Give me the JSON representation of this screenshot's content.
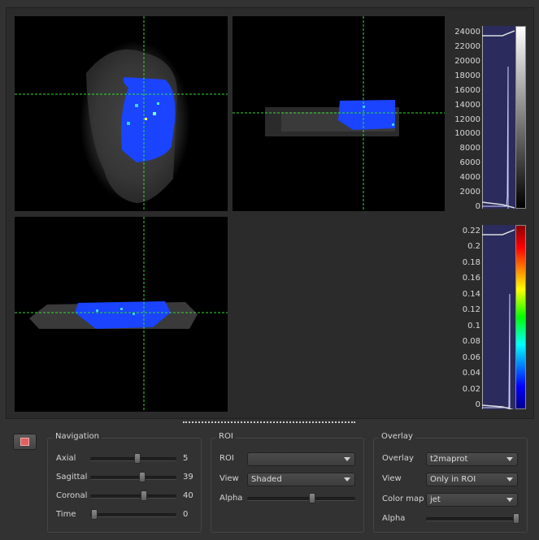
{
  "viewer": {
    "histogram_top": {
      "ticks": [
        "24000",
        "22000",
        "20000",
        "18000",
        "16000",
        "14000",
        "12000",
        "10000",
        "8000",
        "6000",
        "4000",
        "2000",
        "0"
      ],
      "bg_color": "#2b2b5e",
      "gradient": [
        "#000000",
        "#ffffff"
      ]
    },
    "histogram_bottom": {
      "ticks": [
        "0.22",
        "0.2",
        "0.18",
        "0.16",
        "0.14",
        "0.12",
        "0.1",
        "0.08",
        "0.06",
        "0.04",
        "0.02",
        "0"
      ],
      "bg_color": "#2b2b5e",
      "gradient": [
        "#8b0000",
        "#ff0000",
        "#ffff00",
        "#00ff00",
        "#00ffff",
        "#0000ff",
        "#00008b"
      ]
    },
    "crosshair_color": "#33dd33",
    "overlay_color": "#1a44ff"
  },
  "roi_button": {
    "icon": "roi-draw-icon",
    "color": "#e06060"
  },
  "navigation": {
    "title": "Navigation",
    "sliders": [
      {
        "label": "Axial",
        "value": "5",
        "level": 0.55
      },
      {
        "label": "Sagittal",
        "value": "39",
        "level": 0.6
      },
      {
        "label": "Coronal",
        "value": "40",
        "level": 0.62
      },
      {
        "label": "Time",
        "value": "0",
        "level": 0.05
      }
    ]
  },
  "roi": {
    "title": "ROI",
    "roi_label": "ROI",
    "roi_value": "",
    "view_label": "View",
    "view_value": "Shaded",
    "alpha_label": "Alpha",
    "alpha_level": 0.6
  },
  "overlay": {
    "title": "Overlay",
    "overlay_label": "Overlay",
    "overlay_value": "t2maprot",
    "view_label": "View",
    "view_value": "Only in ROI",
    "colormap_label": "Color map",
    "colormap_value": "jet",
    "alpha_label": "Alpha",
    "alpha_level": 0.98
  }
}
